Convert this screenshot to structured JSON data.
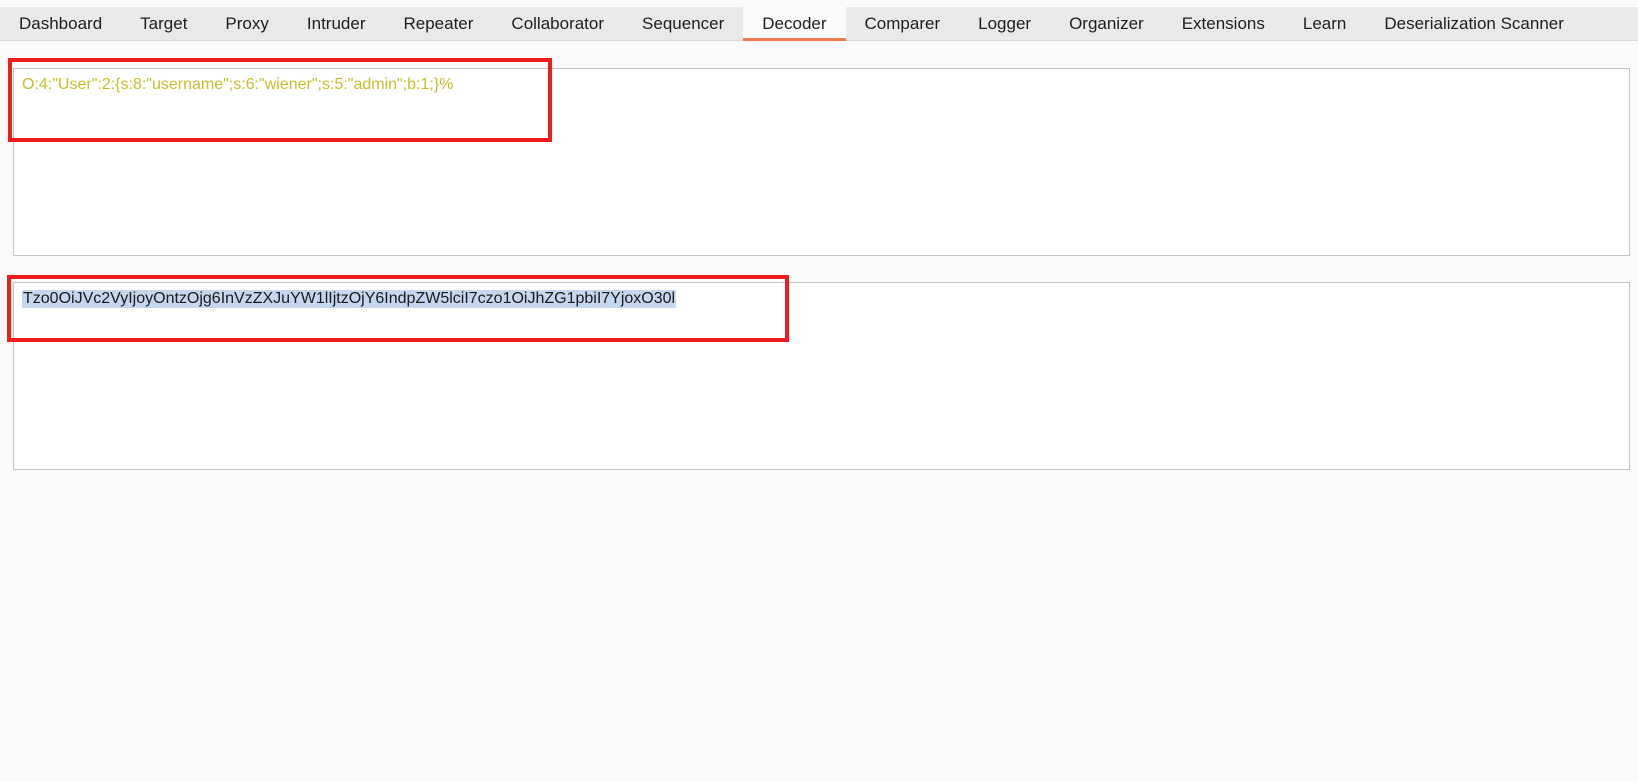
{
  "tabs": [
    {
      "label": "Dashboard",
      "active": false
    },
    {
      "label": "Target",
      "active": false
    },
    {
      "label": "Proxy",
      "active": false
    },
    {
      "label": "Intruder",
      "active": false
    },
    {
      "label": "Repeater",
      "active": false
    },
    {
      "label": "Collaborator",
      "active": false
    },
    {
      "label": "Sequencer",
      "active": false
    },
    {
      "label": "Decoder",
      "active": true
    },
    {
      "label": "Comparer",
      "active": false
    },
    {
      "label": "Logger",
      "active": false
    },
    {
      "label": "Organizer",
      "active": false
    },
    {
      "label": "Extensions",
      "active": false
    },
    {
      "label": "Learn",
      "active": false
    },
    {
      "label": "Deserialization Scanner",
      "active": false
    }
  ],
  "decoder": {
    "input_text": "O:4:\"User\":2:{s:8:\"username\";s:6:\"wiener\";s:5:\"admin\";b:1;}%",
    "output_text": "Tzo0OiJVc2VyIjoyOntzOjg6InVzZXJuYW1lIjtzOjY6IndpZW5lciI7czo1OiJhZG1pbiI7YjoxO30l"
  },
  "colors": {
    "active_tab_underline": "#f07a4a",
    "input_text_color": "#c9bd2a",
    "annotation_box": "#ee1c1c",
    "selection_highlight": "#c5d7ee"
  }
}
